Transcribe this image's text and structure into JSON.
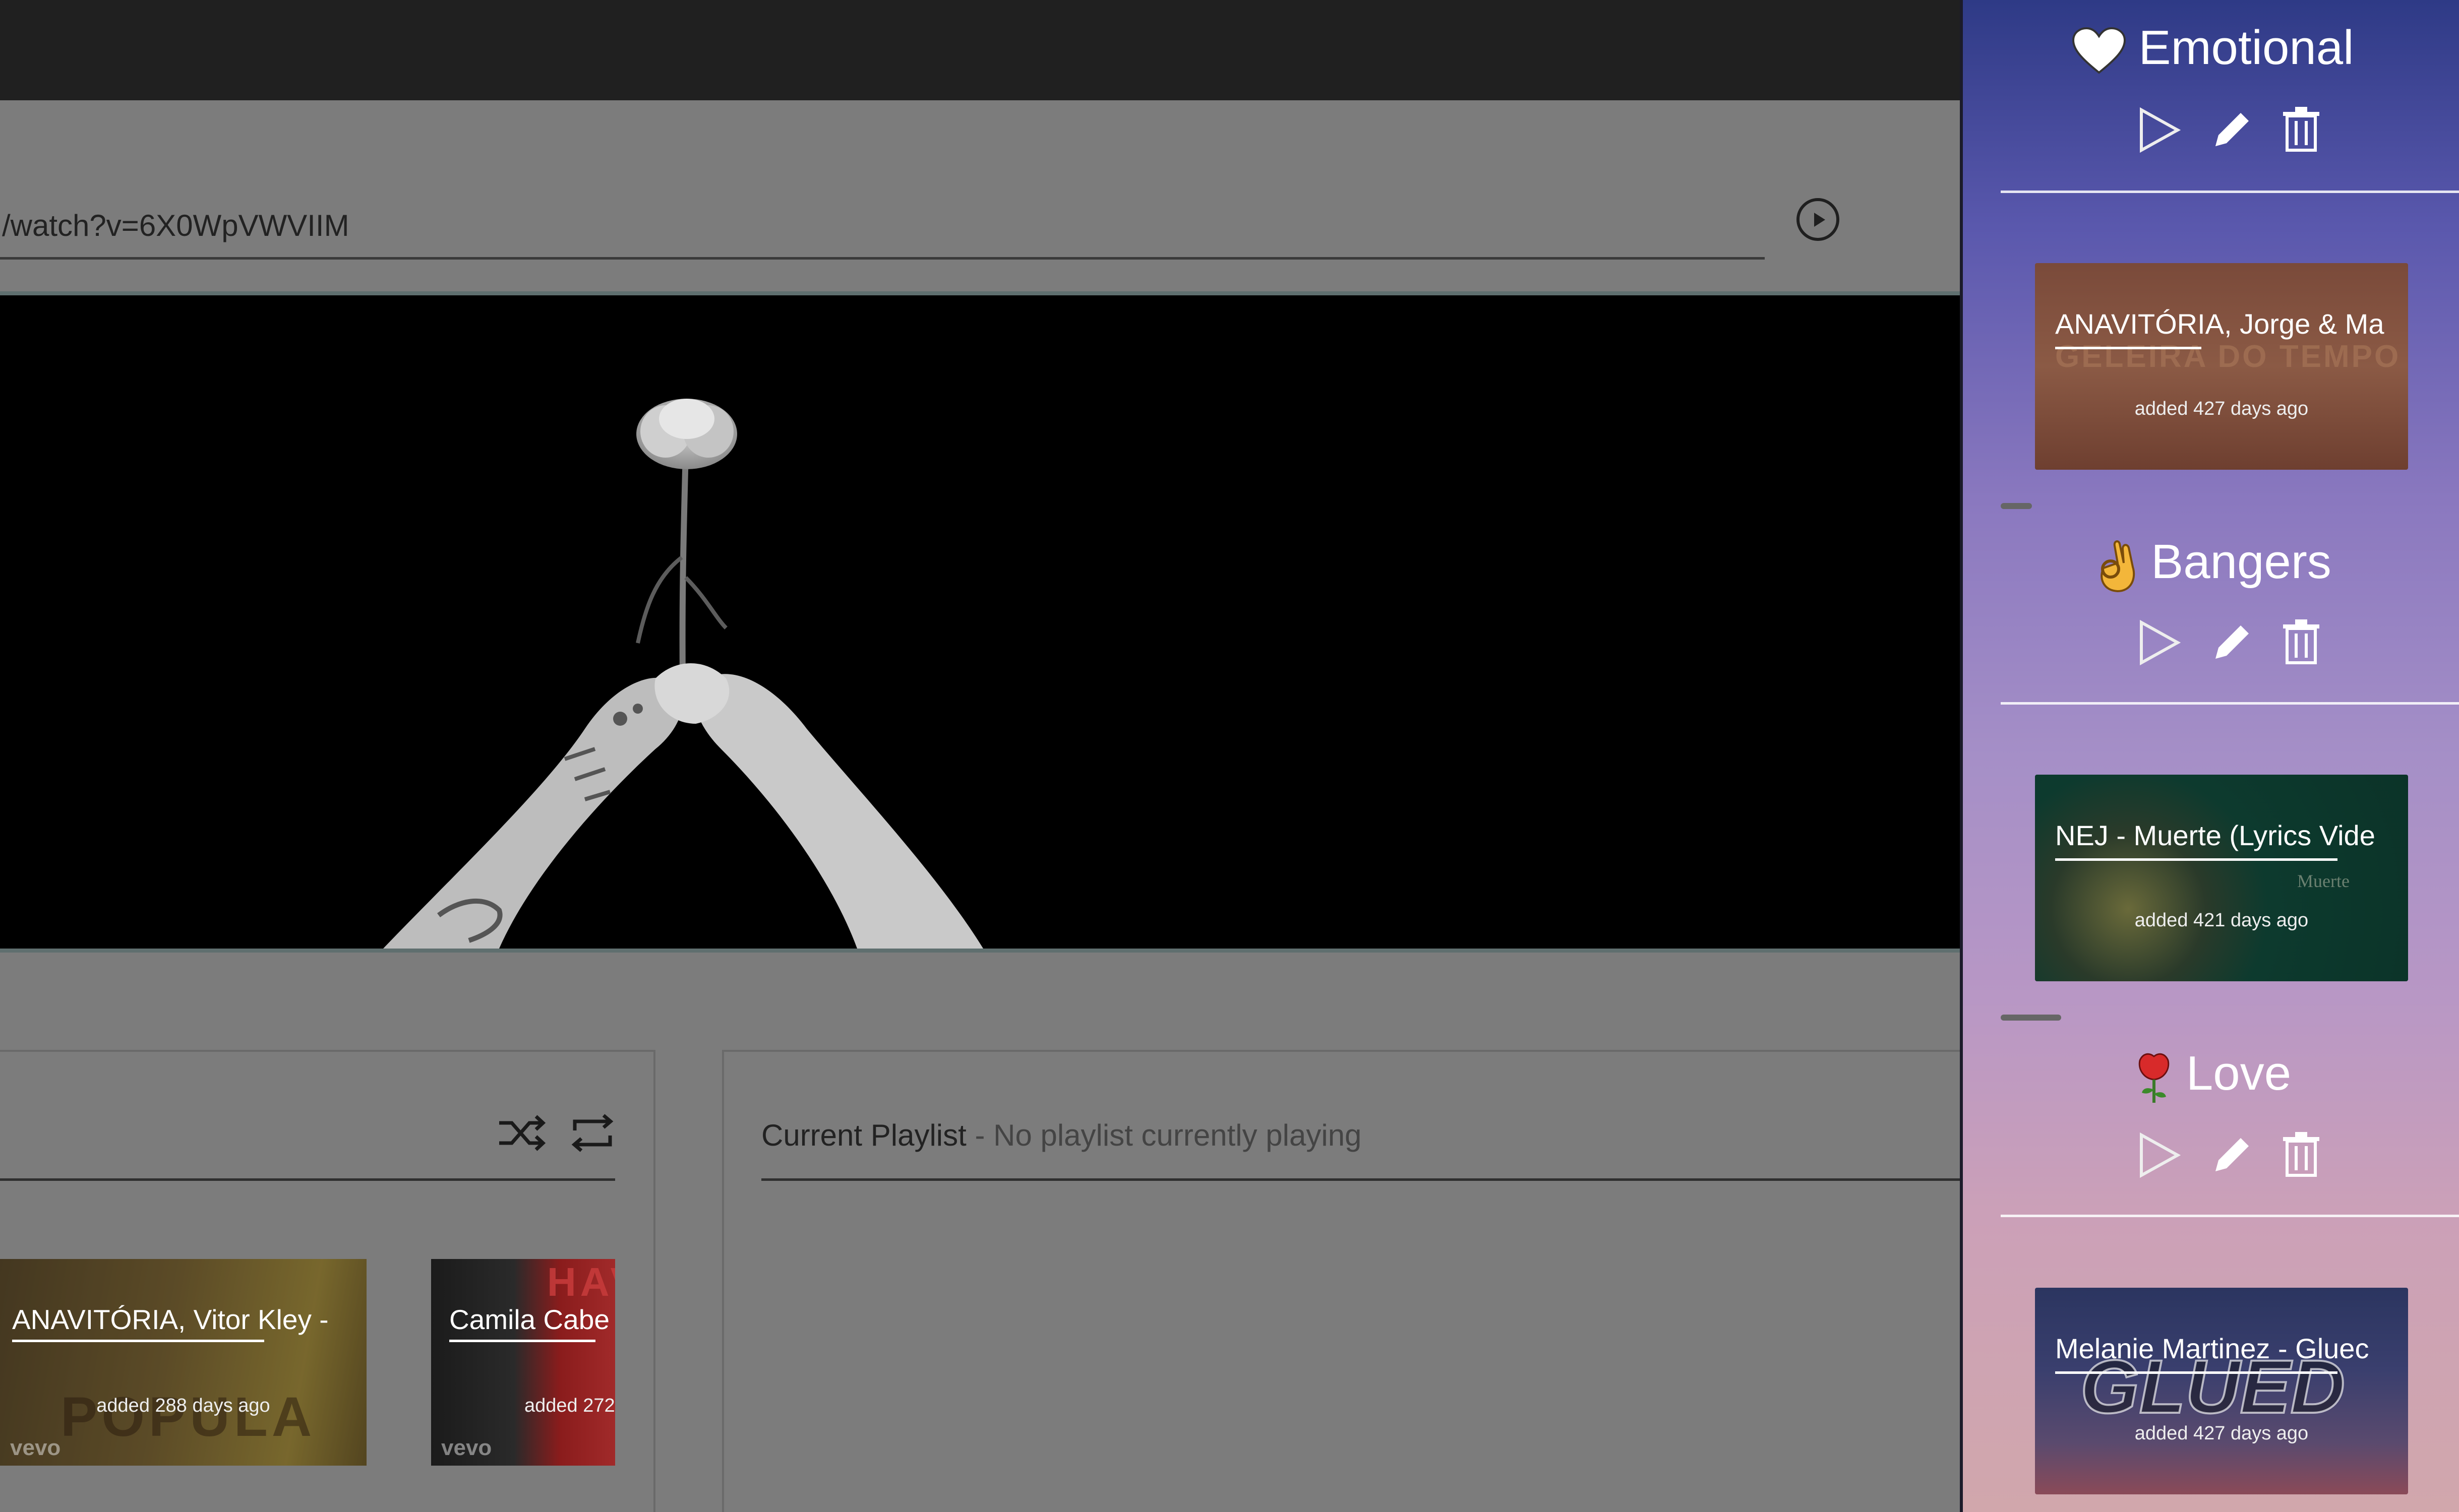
{
  "url_bar": {
    "value": "/watch?v=6X0WpVWVIIM"
  },
  "queue_panel": {
    "cards": [
      {
        "title": "ANAVITÓRIA, Vitor Kley -",
        "added": "added 288 days ago",
        "watermark": "POPULA",
        "badge": "vevo"
      },
      {
        "title": "Camila Cabe",
        "added": "added 272",
        "watermark": "HAV",
        "badge": "vevo"
      }
    ]
  },
  "current_playlist": {
    "label": "Current Playlist",
    "status": " - No playlist currently playing"
  },
  "sidebar": {
    "playlists": [
      {
        "name": "Emotional",
        "emoji": "white-heart",
        "card": {
          "title": "ANAVITÓRIA, Jorge & Ma",
          "added": "added 427 days ago",
          "watermark": "GELEIRA DO TEMPO"
        }
      },
      {
        "name": "Bangers",
        "emoji": "ok-hand",
        "card": {
          "title": "NEJ - Muerte (Lyrics Vide",
          "added": "added 421 days ago",
          "watermark": "Muerte"
        }
      },
      {
        "name": "Love",
        "emoji": "rose",
        "card": {
          "title": "Melanie Martinez - Gluec",
          "added": "added 427 days ago",
          "watermark": "GLUED"
        }
      }
    ]
  },
  "colors": {
    "sidebar_top": "#2e3a86",
    "sidebar_bottom": "#d1a7ac",
    "overlay_gray": "#7c7c7c"
  }
}
